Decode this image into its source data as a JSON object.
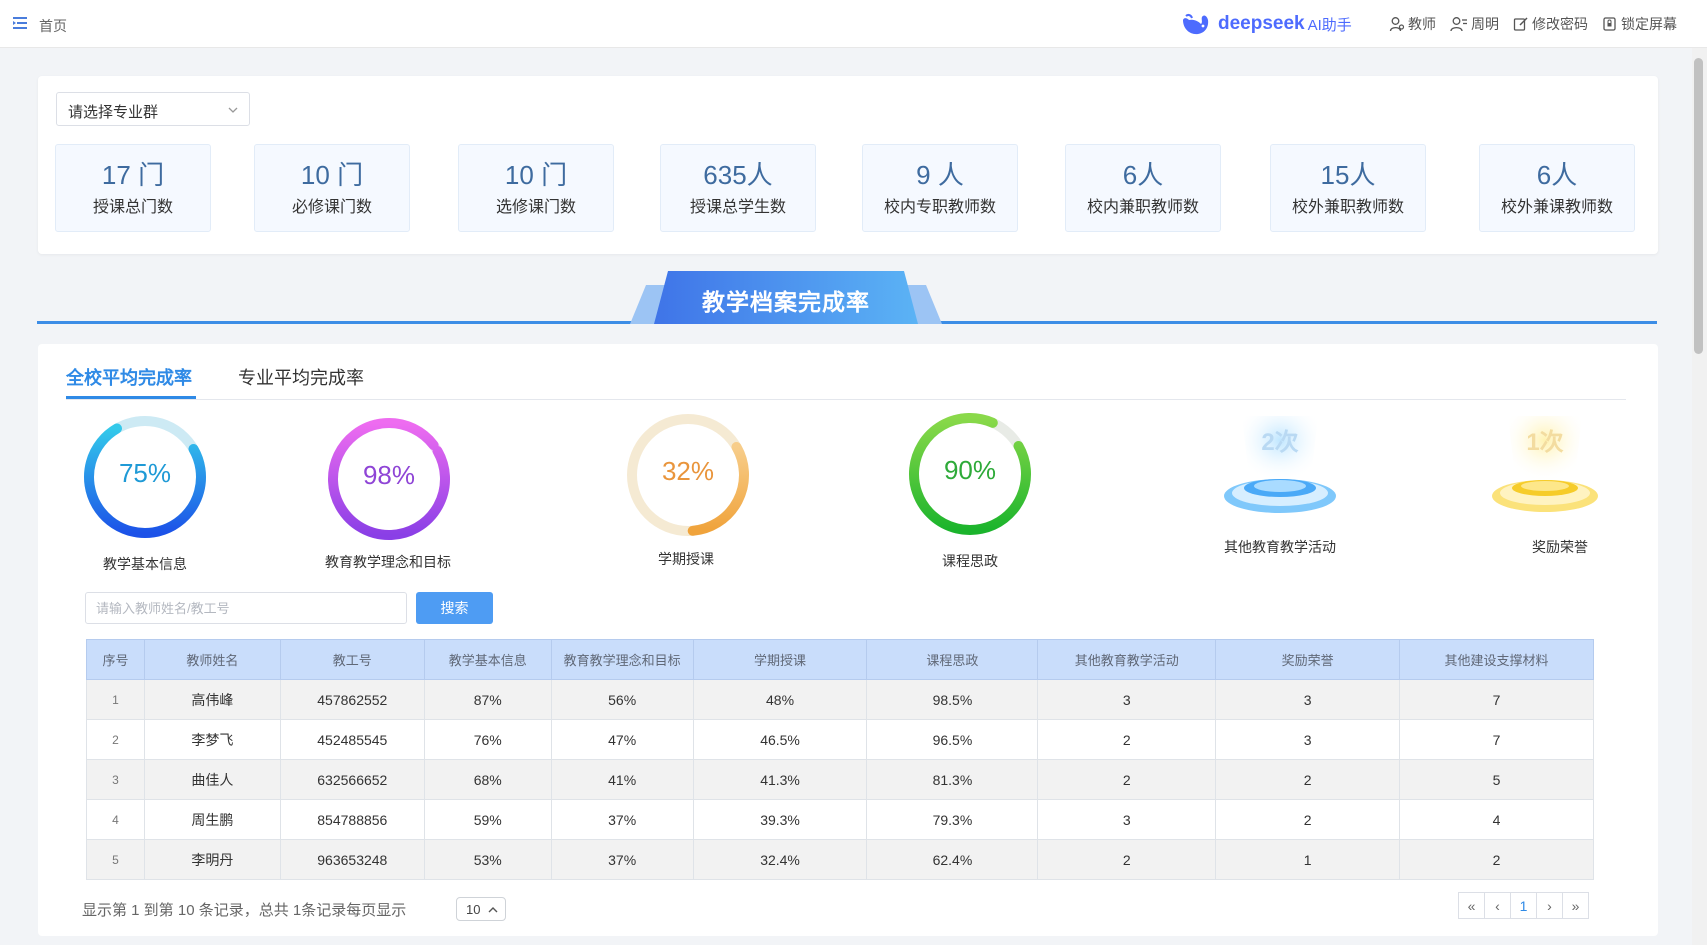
{
  "header": {
    "breadcrumb": "首页",
    "brand": {
      "name": "deepseek",
      "suffix": "AI助手",
      "color": "#4d6bfe"
    },
    "tools": [
      {
        "label": "教师",
        "icon": "role-icon"
      },
      {
        "label": "周明",
        "icon": "user-icon"
      },
      {
        "label": "修改密码",
        "icon": "edit-icon"
      },
      {
        "label": "锁定屏幕",
        "icon": "lock-icon"
      }
    ]
  },
  "filter": {
    "group_placeholder": "请选择专业群"
  },
  "stats": [
    {
      "value": "17 门",
      "label": "授课总门数"
    },
    {
      "value": "10 门",
      "label": "必修课门数"
    },
    {
      "value": "10 门",
      "label": "选修课门数"
    },
    {
      "value": "635人",
      "label": "授课总学生数"
    },
    {
      "value": "9 人",
      "label": "校内专职教师数"
    },
    {
      "value": "6人",
      "label": "校内兼职教师数"
    },
    {
      "value": "15人",
      "label": "校外兼职教师数"
    },
    {
      "value": "6人",
      "label": "校外兼课教师数"
    }
  ],
  "section": {
    "title": "教学档案完成率"
  },
  "tabs": [
    {
      "label": "全校平均完成率",
      "active": true
    },
    {
      "label": "专业平均完成率",
      "active": false
    }
  ],
  "gauges": [
    {
      "label": "教学基本信息",
      "text": "75%",
      "percent": 75,
      "color_a": "#33c9ea",
      "color_b": "#1c52e8",
      "track": "#cdeaf4",
      "text_color": "#1f9ad6"
    },
    {
      "label": "教育教学理念和目标",
      "text": "98%",
      "percent": 98,
      "color_a": "#ee6cf0",
      "color_b": "#8a3fe6",
      "track": "#f1d9f5",
      "text_color": "#8f45d6"
    },
    {
      "label": "学期授课",
      "text": "32%",
      "percent": 32,
      "color_a": "#f7cd8a",
      "color_b": "#f0a33b",
      "track": "#f5ead3",
      "text_color": "#e9953c"
    },
    {
      "label": "课程思政",
      "text": "90%",
      "percent": 90,
      "color_a": "#8ad94a",
      "color_b": "#1bb42c",
      "track": "#e8ebe6",
      "text_color": "#2eaa39"
    }
  ],
  "counts": [
    {
      "label": "其他教育教学活动",
      "value": "2次",
      "color": "#3aa6f5"
    },
    {
      "label": "奖励荣誉",
      "value": "1次",
      "color": "#f5c52b"
    }
  ],
  "search": {
    "placeholder": "请输入教师姓名/教工号",
    "button": "搜索"
  },
  "table": {
    "headers": [
      "序号",
      "教师姓名",
      "教工号",
      "教学基本信息",
      "教育教学理念和目标",
      "学期授课",
      "课程思政",
      "其他教育教学活动",
      "奖励荣誉",
      "其他建设支撑材料"
    ],
    "rows": [
      [
        "1",
        "高伟峰",
        "457862552",
        "87%",
        "56%",
        "48%",
        "98.5%",
        "3",
        "3",
        "7"
      ],
      [
        "2",
        "李梦飞",
        "452485545",
        "76%",
        "47%",
        "46.5%",
        "96.5%",
        "2",
        "3",
        "7"
      ],
      [
        "3",
        "曲佳人",
        "632566652",
        "68%",
        "41%",
        "41.3%",
        "81.3%",
        "2",
        "2",
        "5"
      ],
      [
        "4",
        "周生鹏",
        "854788856",
        "59%",
        "37%",
        "39.3%",
        "79.3%",
        "3",
        "2",
        "4"
      ],
      [
        "5",
        "李明丹",
        "963653248",
        "53%",
        "37%",
        "32.4%",
        "62.4%",
        "2",
        "1",
        "2"
      ]
    ]
  },
  "pagination": {
    "info": "显示第 1 到第 10 条记录，总共 1条记录每页显示",
    "page_size": "10",
    "first": "«",
    "prev": "‹",
    "current": "1",
    "next": "›",
    "last": "»"
  }
}
